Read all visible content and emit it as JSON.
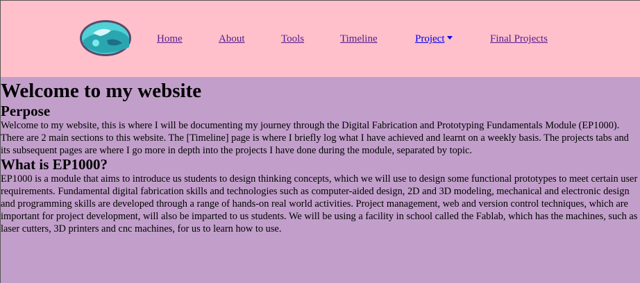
{
  "nav": {
    "logo_name": "logo-image",
    "items": [
      {
        "label": "Home"
      },
      {
        "label": "About"
      },
      {
        "label": "Tools"
      },
      {
        "label": "Timeline"
      },
      {
        "label": "Project"
      },
      {
        "label": "Final Projects"
      }
    ]
  },
  "main": {
    "title": "Welcome to my website",
    "section1": {
      "heading": "Perpose",
      "body": "Welcome to my website, this is where I will be documenting my journey through the Digital Fabrication and Prototyping Fundamentals Module (EP1000). There are 2 main sections to this website. The [Timeline] page is where I briefly log what I have achieved and learnt on a weekly basis. The projects tabs and its subsequent pages are where I go more in depth into the projects I have done during the module, separated by topic."
    },
    "section2": {
      "heading": "What is EP1000?",
      "body": "EP1000 is a module that aims to introduce us students to design thinking concepts, which we will use to design some functional prototypes to meet certain user requirements. Fundamental digital fabrication skills and technologies such as computer-aided design, 2D and 3D modeling, mechanical and electronic design and programming skills are developed through a range of hands-on real world activities. Project management, web and version control techniques, which are important for project development, will also be imparted to us students. We will be using a facility in school called the Fablab, which has the machines, such as laser cutters, 3D printers and cnc machines, for us to learn how to use."
    }
  },
  "colors": {
    "navbar_bg": "#ffc0cb",
    "page_bg": "#c29fcb",
    "visited_link": "#551a8b",
    "link": "#0000ee"
  }
}
